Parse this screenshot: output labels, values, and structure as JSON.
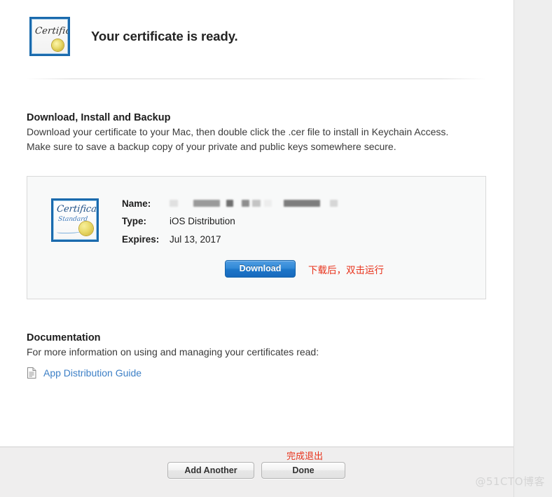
{
  "header": {
    "title": "Your certificate is ready.",
    "icon_label": "Certificate",
    "icon_name": "certificate-icon"
  },
  "download_section": {
    "heading": "Download, Install and Backup",
    "body": "Download your certificate to your Mac, then double click the .cer file to install in Keychain Access. Make sure to save a backup copy of your private and public keys somewhere secure."
  },
  "certificate_card": {
    "thumbnail": {
      "line1": "Certificate",
      "line2": "Standard"
    },
    "rows": [
      {
        "label": "Name:",
        "value": "",
        "redacted": true
      },
      {
        "label": "Type:",
        "value": "iOS Distribution",
        "redacted": false
      },
      {
        "label": "Expires:",
        "value": "Jul 13, 2017",
        "redacted": false
      }
    ],
    "download_button": "Download",
    "annotation_cn": "下载后，双击运行"
  },
  "documentation_section": {
    "heading": "Documentation",
    "body": "For more information on using and managing your certificates read:",
    "link_text": "App Distribution Guide",
    "link_icon": "document-icon"
  },
  "footer": {
    "add_another_label": "Add Another",
    "done_label": "Done",
    "annotation_cn": "完成退出"
  },
  "watermark": {
    "text": "@51CTO博客"
  },
  "colors": {
    "accent_blue": "#1d76c8",
    "link_blue": "#3c7fc6",
    "annotation_red": "#e8321b",
    "card_bg": "#f8f9f9",
    "card_border": "#d9d9d9",
    "footer_bg": "#efeeee",
    "page_bg": "#ffffff",
    "outer_bg": "#eeeeee",
    "cert_border_blue": "#1a6aad",
    "seal_gold": "#e5d661"
  },
  "redaction_blocks": [
    {
      "width": 12,
      "color": "#e0e0e0"
    },
    {
      "gap": 22
    },
    {
      "width": 38,
      "color": "#9a9a9a"
    },
    {
      "gap": 9
    },
    {
      "width": 10,
      "color": "#6f6f6f"
    },
    {
      "gap": 12
    },
    {
      "width": 11,
      "color": "#8e8e8e"
    },
    {
      "gap": 4
    },
    {
      "width": 12,
      "color": "#c4c4c4"
    },
    {
      "gap": 5
    },
    {
      "width": 11,
      "color": "#ededed"
    },
    {
      "gap": 17
    },
    {
      "width": 52,
      "color": "#7d7d7d"
    },
    {
      "gap": 14
    },
    {
      "width": 11,
      "color": "#d6d6d6"
    }
  ]
}
